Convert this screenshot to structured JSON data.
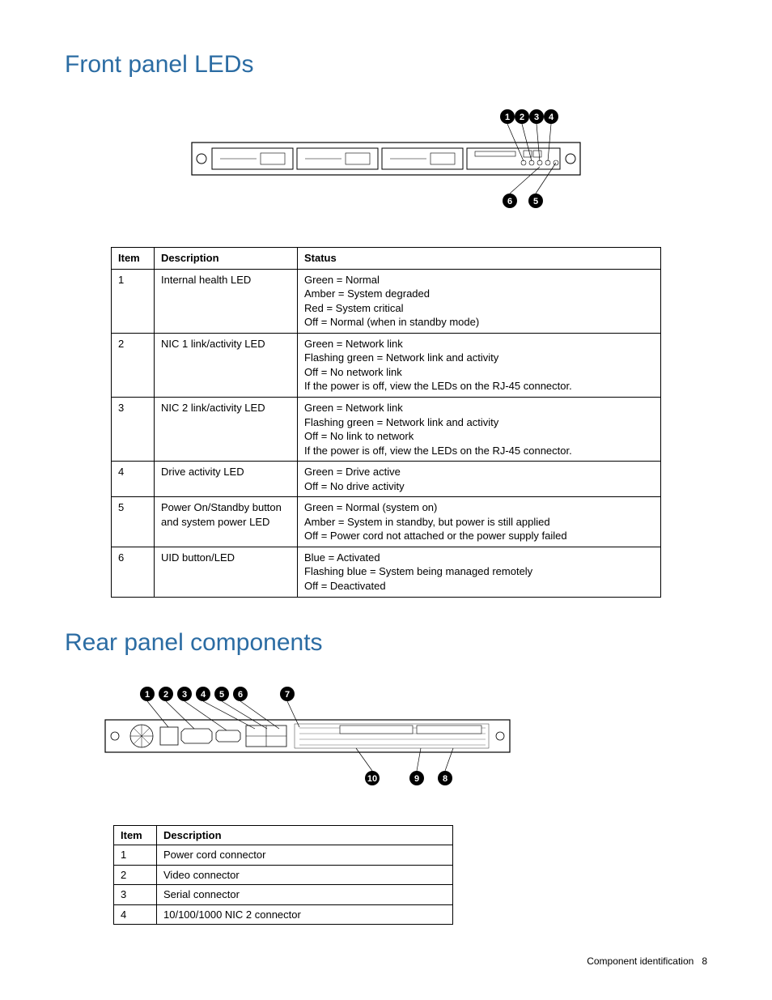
{
  "section1": {
    "title": "Front panel LEDs",
    "headers": {
      "item": "Item",
      "description": "Description",
      "status": "Status"
    },
    "rows": [
      {
        "item": "1",
        "desc": "Internal health LED",
        "status": [
          "Green = Normal",
          "Amber = System degraded",
          "Red = System critical",
          "Off = Normal (when in standby mode)"
        ]
      },
      {
        "item": "2",
        "desc": "NIC 1 link/activity LED",
        "status": [
          "Green = Network link",
          "Flashing green = Network link and activity",
          "Off = No network link",
          "If the power is off, view the LEDs on the RJ-45 connector."
        ]
      },
      {
        "item": "3",
        "desc": "NIC 2 link/activity LED",
        "status": [
          "Green = Network link",
          "Flashing green = Network link and activity",
          "Off = No link to network",
          "If the power is off, view the LEDs on the RJ-45 connector."
        ]
      },
      {
        "item": "4",
        "desc": "Drive activity LED",
        "status": [
          "Green = Drive active",
          "Off = No drive activity"
        ]
      },
      {
        "item": "5",
        "desc": "Power On/Standby button and system power LED",
        "status": [
          "Green = Normal (system on)",
          "Amber = System in standby, but power is still applied",
          "Off = Power cord   not attached or the power supply   failed"
        ]
      },
      {
        "item": "6",
        "desc": "UID button/LED",
        "status": [
          "Blue = Activated",
          "Flashing blue = System being managed remotely",
          "Off = Deactivated"
        ]
      }
    ],
    "callouts_top": [
      "1",
      "2",
      "3",
      "4"
    ],
    "callouts_bottom": [
      "6",
      "5"
    ]
  },
  "section2": {
    "title": "Rear panel components",
    "headers": {
      "item": "Item",
      "description": "Description"
    },
    "rows": [
      {
        "item": "1",
        "desc": "Power cord connector"
      },
      {
        "item": "2",
        "desc": "Video connector"
      },
      {
        "item": "3",
        "desc": "Serial connector"
      },
      {
        "item": "4",
        "desc": "10/100/1000 NIC 2 connector"
      }
    ],
    "callouts_top": [
      "1",
      "2",
      "3",
      "4",
      "5",
      "6",
      "7"
    ],
    "callouts_bottom": [
      "10",
      "9",
      "8"
    ]
  },
  "footer": {
    "section": "Component identification",
    "page": "8"
  }
}
